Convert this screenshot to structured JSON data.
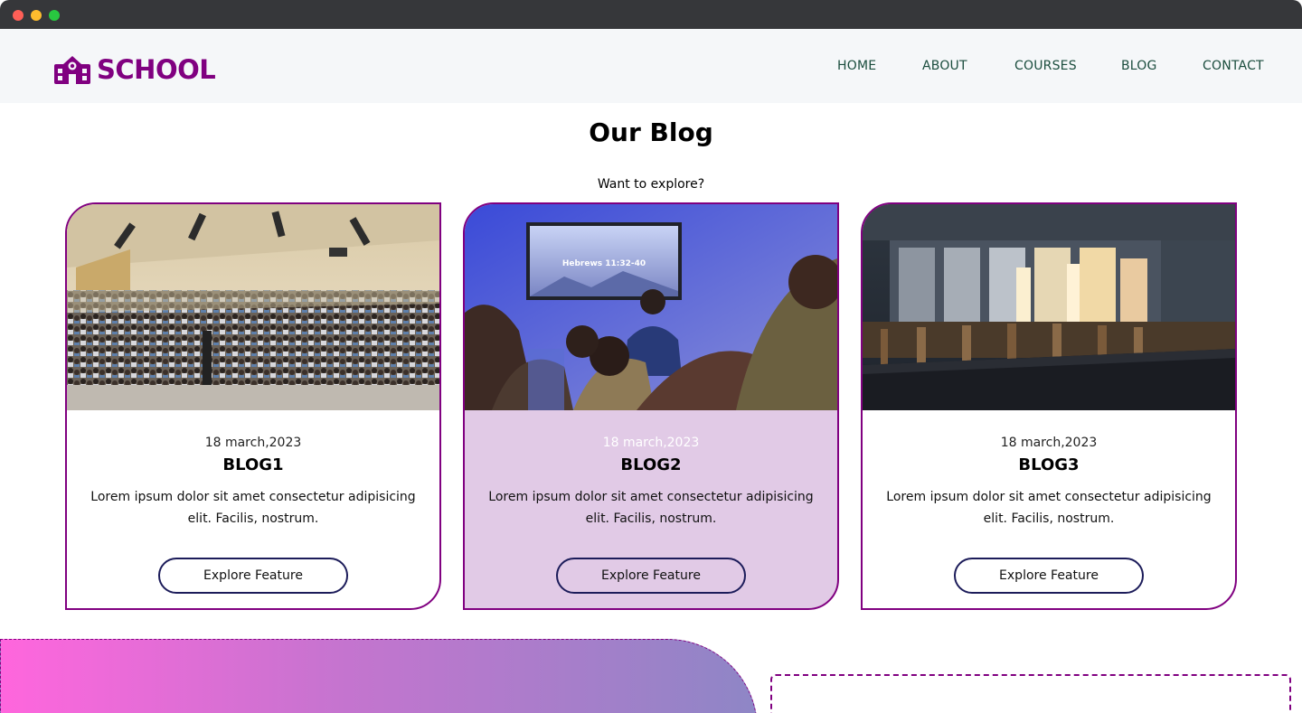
{
  "window": {
    "controls": [
      "close",
      "minimize",
      "maximize"
    ]
  },
  "header": {
    "logo_text": "SCHOOL",
    "logo_icon": "school-building-icon",
    "nav": [
      {
        "label": "HOME"
      },
      {
        "label": "ABOUT"
      },
      {
        "label": "COURSES"
      },
      {
        "label": "BLOG"
      },
      {
        "label": "CONTACT"
      }
    ]
  },
  "blog": {
    "title": "Our Blog",
    "subtitle": "Want to explore?",
    "cards": [
      {
        "image": "lecture-hall-audience-photo",
        "date": "18 march,2023",
        "title": "BLOG1",
        "text": "Lorem ipsum dolor sit amet consectetur adipisicing elit. Facilis, nostrum.",
        "button": "Explore Feature"
      },
      {
        "image": "speaker-presentation-photo",
        "date": "18 march,2023",
        "title": "BLOG2",
        "text": "Lorem ipsum dolor sit amet consectetur adipisicing elit. Facilis, nostrum.",
        "button": "Explore Feature",
        "screen_text": "Hebrews 11:32-40"
      },
      {
        "image": "empty-classroom-photo",
        "date": "18 march,2023",
        "title": "BLOG3",
        "text": "Lorem ipsum dolor sit amet consectetur adipisicing elit. Facilis, nostrum.",
        "button": "Explore Feature"
      }
    ]
  },
  "colors": {
    "brand": "#800080",
    "nav_text": "#1b4d3e",
    "highlight_card": "#e1cae6",
    "button_border": "#1c1c5a",
    "header_bg": "#f5f7f9"
  }
}
